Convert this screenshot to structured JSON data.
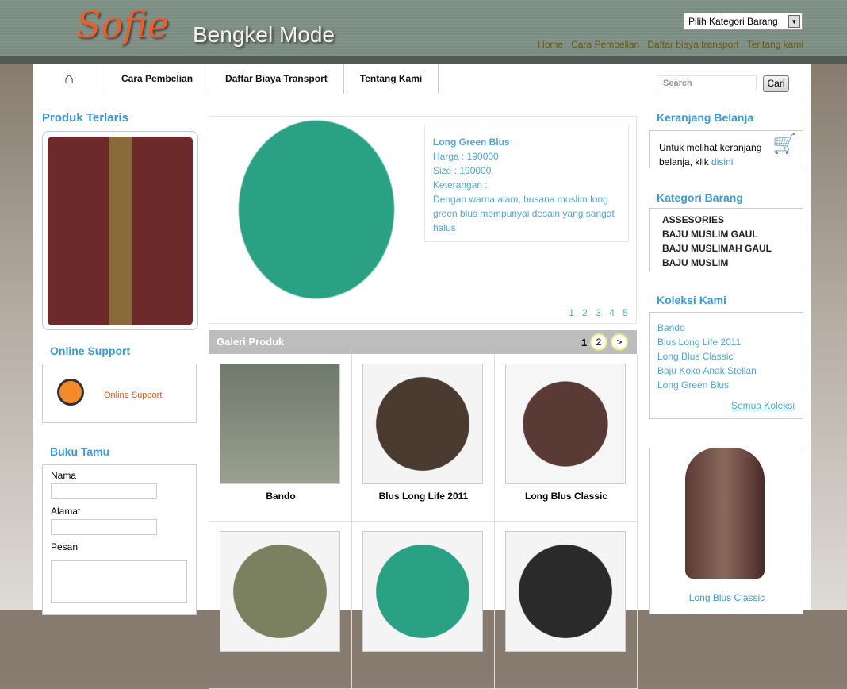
{
  "header": {
    "logo_script": "Sofie",
    "logo_text": "Bengkel Mode",
    "category_select": "Pilih Kategori Barang",
    "top_links": [
      "Home",
      "Cara Pembelian",
      "Daftar biaya transport",
      "Tentang kami"
    ]
  },
  "nav": {
    "items": [
      "Cara Pembelian",
      "Daftar Biaya Transport",
      "Tentang Kami"
    ],
    "search_placeholder": "Search",
    "search_button": "Cari"
  },
  "left": {
    "best_title": "Produk Terlaris",
    "support_title": "Online Support",
    "support_label": "Online Support",
    "guestbook_title": "Buku Tamu",
    "fields": [
      "Nama",
      "Alamat",
      "Pesan"
    ]
  },
  "slider": {
    "title": "Long Green Blus",
    "price": "Harga : 190000",
    "size": "Size : 190000",
    "desc_label": "Keterangan :",
    "desc": "Dengan warna alam, busana muslim long green blus mempunyai desain yang sangat halus",
    "pages": "1 2 3 4 5"
  },
  "gallery": {
    "title": "Galeri Produk",
    "current_page": "1",
    "next_page": "2",
    "next": ">",
    "items": [
      "Bando",
      "Blus Long Life 2011",
      "Long Blus Classic",
      "",
      "",
      ""
    ]
  },
  "right": {
    "cart_title": "Keranjang Belanja",
    "cart_text": "Untuk melihat keranjang belanja, klik",
    "cart_link": "disini",
    "category_title": "Kategori Barang",
    "categories": [
      "ASSESORIES",
      "BAJU MUSLIM GAUL",
      "BAJU MUSLIMAH GAUL",
      "BAJU MUSLIM"
    ],
    "collection_title": "Koleksi Kami",
    "collections": [
      "Bando",
      "Blus Long Life 2011",
      "Long Blus Classic",
      "Baju Koko Anak Stellan",
      "Long Green Blus"
    ],
    "all_collections": "Semua Koleksi",
    "featured_caption": "Long Blus Classic"
  },
  "colors": {
    "accent": "#3a9ad9",
    "logo": "#e8602c",
    "header_bg": "#7f9087"
  }
}
